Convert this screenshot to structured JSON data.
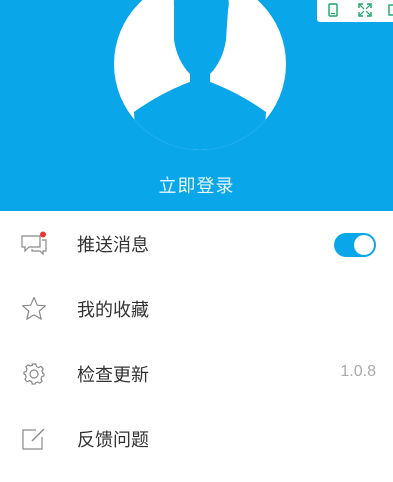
{
  "header": {
    "login_label": "立即登录",
    "bg_color": "#0aa6ea",
    "avatar_icon": "user-silhouette-icon"
  },
  "topbar": {
    "icons": [
      "phone-portrait-icon",
      "expand-icon",
      "window-icon"
    ],
    "accent": "#1aa36a"
  },
  "menu": {
    "items": [
      {
        "label": "推送消息",
        "icon": "chat-bubble-icon",
        "toggle_on": true
      },
      {
        "label": "我的收藏",
        "icon": "star-icon"
      },
      {
        "label": "检查更新",
        "icon": "gear-icon",
        "value": "1.0.8"
      },
      {
        "label": "反馈问题",
        "icon": "edit-icon"
      }
    ]
  }
}
